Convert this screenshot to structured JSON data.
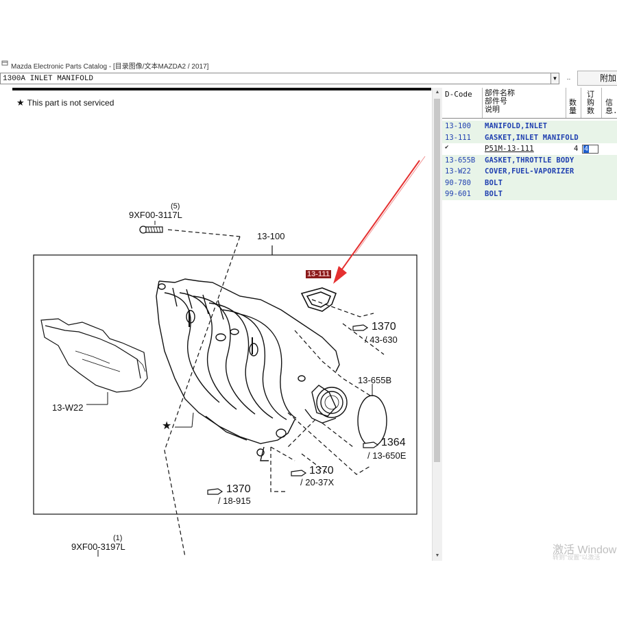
{
  "window": {
    "title": "Mazda Electronic Parts Catalog - [目录图像/文本MAZDA2 / 2017]"
  },
  "toolbar": {
    "section_value": "1300A  INLET MANIFOLD",
    "dropdown_arrow": "▼",
    "dots_label": "..",
    "attach_label": "附加"
  },
  "notice": {
    "star": "★",
    "text": "This part is not serviced"
  },
  "diagram": {
    "labels": {
      "bolt_top_qty": "(5)",
      "bolt_top_code": "9XF00-3117L",
      "manifold": "13-100",
      "gasket_highlight": "13-111",
      "ref_1370_a": "1370",
      "ref_43_630": "/ 43-630",
      "gasket_throttle": "13-655B",
      "cover": "13-W22",
      "ref_1364": "1364",
      "ref_13_650e": "/ 13-650E",
      "ref_1370_b": "1370",
      "ref_20_37x": "/ 20-37X",
      "ref_1370_c": "1370",
      "ref_18_915": "/ 18-915",
      "bolt_bottom_qty": "(1)",
      "bolt_bottom_code": "9XF00-3197L",
      "star_mark": "★"
    },
    "arrow_color": "#e53030"
  },
  "parts": {
    "headers": {
      "dcode": "D-Code",
      "name_line1": "部件名称",
      "name_line2": "部件号",
      "name_line3": "说明",
      "qty": [
        "数",
        "量"
      ],
      "order": [
        "订",
        "购",
        "数"
      ],
      "info": [
        "信",
        "息."
      ]
    },
    "rows": [
      {
        "code": "13-100",
        "name": "MANIFOLD,INLET"
      },
      {
        "code": "13-111",
        "name": "GASKET,INLET MANIFOLD"
      },
      {
        "code": "",
        "name": "P51M-13-111",
        "qty": "4",
        "order": "4",
        "checkbox": "✔"
      },
      {
        "code": "13-655B",
        "name": "GASKET,THROTTLE BODY"
      },
      {
        "code": "13-W22",
        "name": "COVER,FUEL-VAPORIZER"
      },
      {
        "code": "90-780",
        "name": "BOLT"
      },
      {
        "code": "99-601",
        "name": "BOLT"
      }
    ],
    "link_color": "#1f3fb0",
    "row_highlight_color": "#e8f4e8"
  },
  "watermark": {
    "line1": "激活 Window",
    "line2": "转到\"设置\"以激活"
  }
}
